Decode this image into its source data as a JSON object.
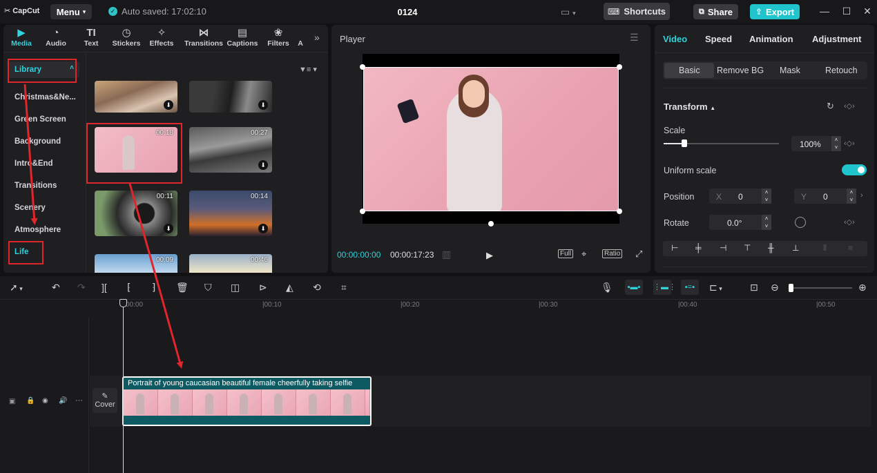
{
  "app": {
    "logo": "CapCut",
    "menu_label": "Menu",
    "autosave": "Auto saved: 17:02:10",
    "project_title": "0124",
    "shortcuts_label": "Shortcuts",
    "share_label": "Share",
    "export_label": "Export",
    "accent": "#20c4cc"
  },
  "left": {
    "tabs": [
      {
        "label": "Media",
        "icon": "media-icon"
      },
      {
        "label": "Audio",
        "icon": "audio-icon"
      },
      {
        "label": "Text",
        "icon": "text-icon"
      },
      {
        "label": "Stickers",
        "icon": "stickers-icon"
      },
      {
        "label": "Effects",
        "icon": "effects-icon"
      },
      {
        "label": "Transitions",
        "icon": "transitions-icon"
      },
      {
        "label": "Captions",
        "icon": "captions-icon"
      },
      {
        "label": "Filters",
        "icon": "filters-icon"
      }
    ],
    "library_label": "Library",
    "categories": [
      "Christmas&Ne...",
      "Green Screen",
      "Background",
      "Intro&End",
      "Transitions",
      "Scenery",
      "Atmosphere",
      "Life"
    ],
    "thumbs": [
      {
        "duration": ""
      },
      {
        "duration": ""
      },
      {
        "duration": "00:18"
      },
      {
        "duration": "00:27"
      },
      {
        "duration": "00:11"
      },
      {
        "duration": "00:14"
      },
      {
        "duration": "00:09"
      },
      {
        "duration": "00:46"
      }
    ]
  },
  "player": {
    "title": "Player",
    "current_time": "00:00:00:00",
    "total_time": "00:00:17:23",
    "full_label": "Full",
    "ratio_label": "Ratio"
  },
  "right": {
    "tabs": [
      "Video",
      "Speed",
      "Animation",
      "Adjustment"
    ],
    "subtabs": [
      "Basic",
      "Remove BG",
      "Mask",
      "Retouch"
    ],
    "transform_label": "Transform",
    "scale_label": "Scale",
    "scale_value": "100%",
    "scale_fraction": 0.18,
    "uniform_scale_label": "Uniform scale",
    "uniform_scale_on": true,
    "position_label": "Position",
    "pos_x_label": "X",
    "pos_x": "0",
    "pos_y_label": "Y",
    "pos_y": "0",
    "rotate_label": "Rotate",
    "rotate_value": "0.0°"
  },
  "timeline": {
    "ruler": [
      "00:00",
      "|00:10",
      "|00:20",
      "|00:30",
      "|00:40",
      "|00:50"
    ],
    "clip_title": "Portrait of young caucasian beautiful female cheerfully taking selfie",
    "cover_label": "Cover"
  }
}
